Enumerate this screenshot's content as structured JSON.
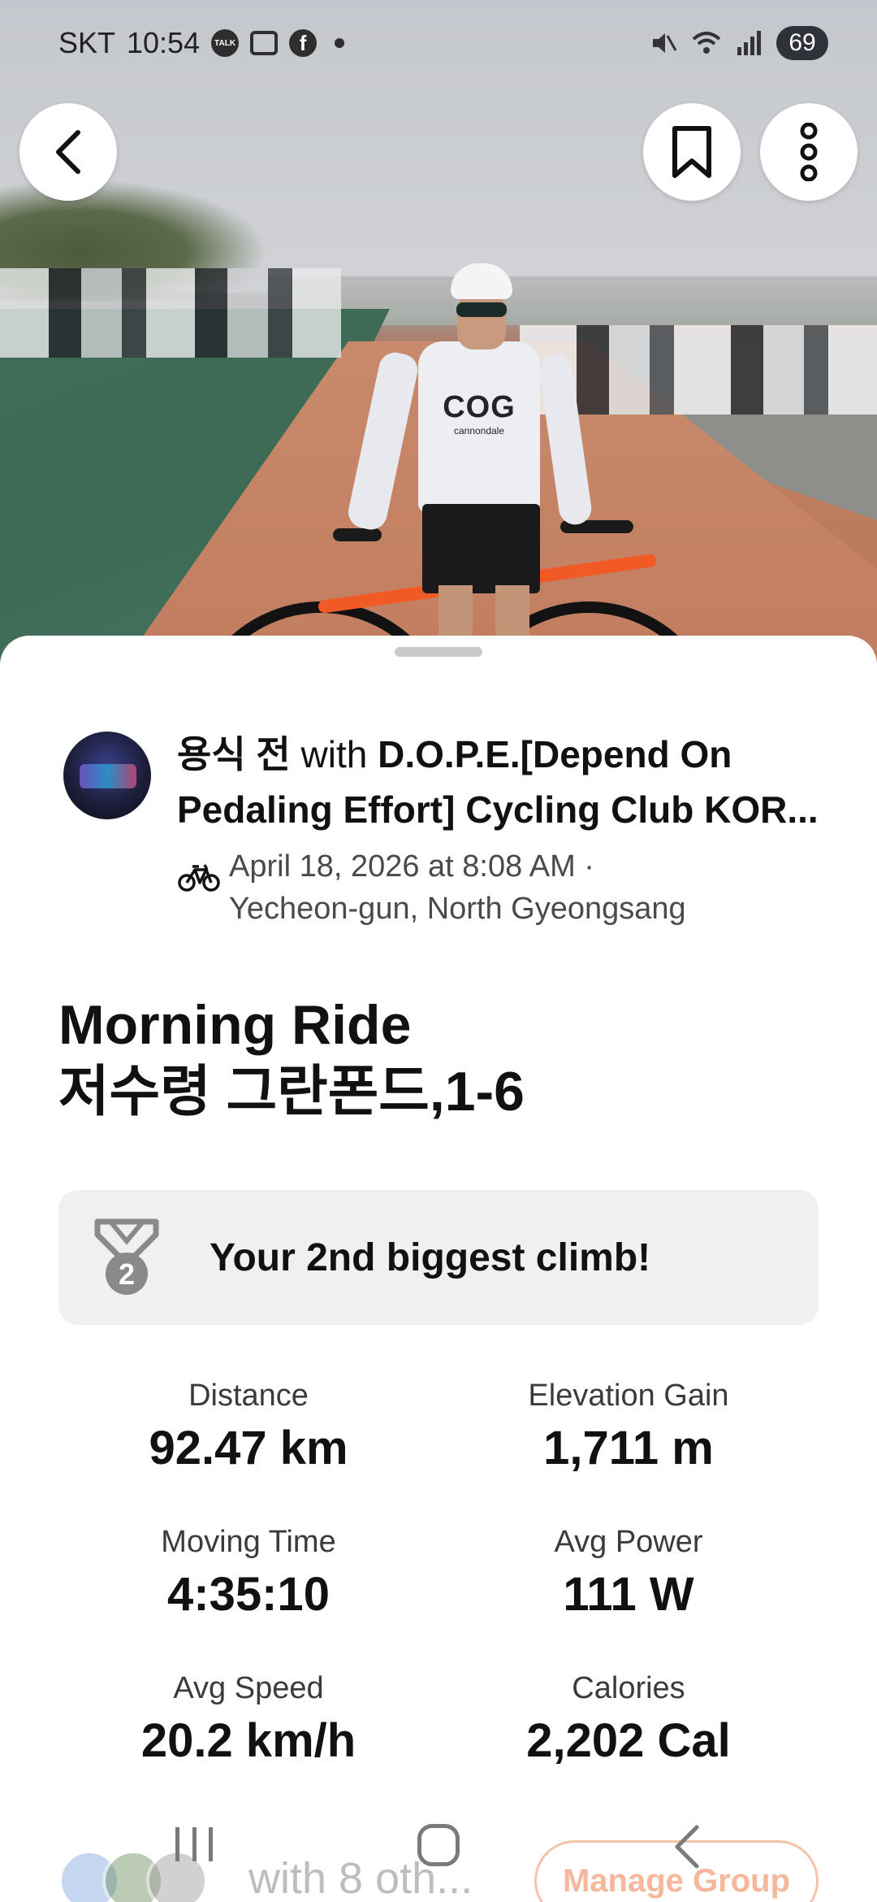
{
  "status_bar": {
    "carrier": "SKT",
    "time": "10:54",
    "talk_badge": "TALK",
    "battery": "69"
  },
  "post": {
    "author": "용식 전",
    "with_word": "with",
    "club": "D.O.P.E.[Depend On Pedaling Effort] Cycling Club KOR...",
    "date": "April 18, 2026 at 8:08 AM ·",
    "location": "Yecheon-gun, North Gyeongsang",
    "activity_type_icon": "bike-icon"
  },
  "activity": {
    "title_line1": "Morning Ride",
    "title_line2": "저수령 그란폰드,1-6"
  },
  "achievement": {
    "text": "Your 2nd biggest climb!",
    "medal_number": "2"
  },
  "stats": [
    {
      "label": "Distance",
      "value": "92.47 km"
    },
    {
      "label": "Elevation Gain",
      "value": "1,711 m"
    },
    {
      "label": "Moving Time",
      "value": "4:35:10"
    },
    {
      "label": "Avg Power",
      "value": "111 W"
    },
    {
      "label": "Avg Speed",
      "value": "20.2 km/h"
    },
    {
      "label": "Calories",
      "value": "2,202 Cal"
    }
  ],
  "footer": {
    "with_others": "with 8 oth...",
    "manage_group": "Manage Group"
  },
  "photo": {
    "jersey_logo": "COG",
    "jersey_sub": "cannondale"
  },
  "colors": {
    "accent": "#fc5200",
    "card_bg": "#f0f0ef",
    "medal": "#8a8a8a"
  }
}
